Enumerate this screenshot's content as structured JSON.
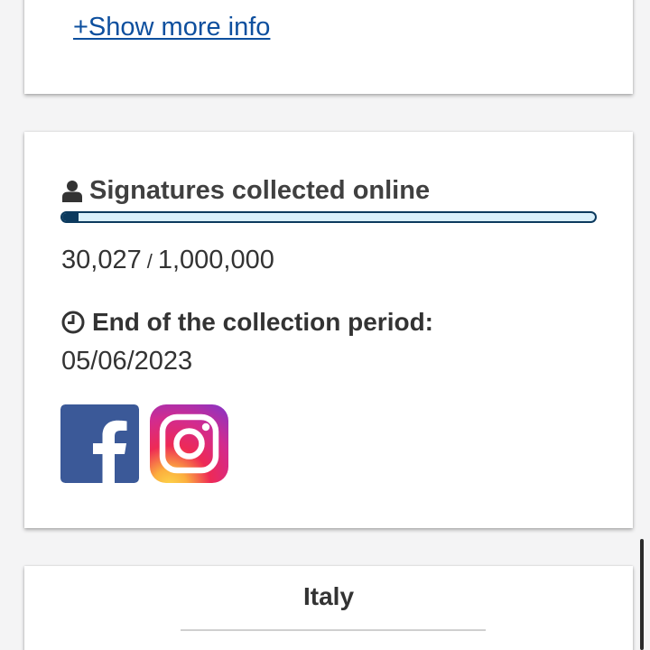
{
  "top_card": {
    "show_more_label": "+Show more info"
  },
  "signatures": {
    "title": "Signatures collected online",
    "collected": "30,027",
    "separator": "/",
    "goal": "1,000,000",
    "progress_fraction": 0.030027
  },
  "collection_period": {
    "title": "End of the collection period:",
    "end_date": "05/06/2023"
  },
  "social": {
    "items": [
      {
        "icon": "facebook-icon"
      },
      {
        "icon": "instagram-icon"
      }
    ]
  },
  "country_card": {
    "name": "Italy"
  },
  "colors": {
    "link": "#0d4f9e",
    "progress_fill": "#0c3a5e",
    "progress_track": "#daf0fb",
    "facebook": "#3b5998"
  }
}
